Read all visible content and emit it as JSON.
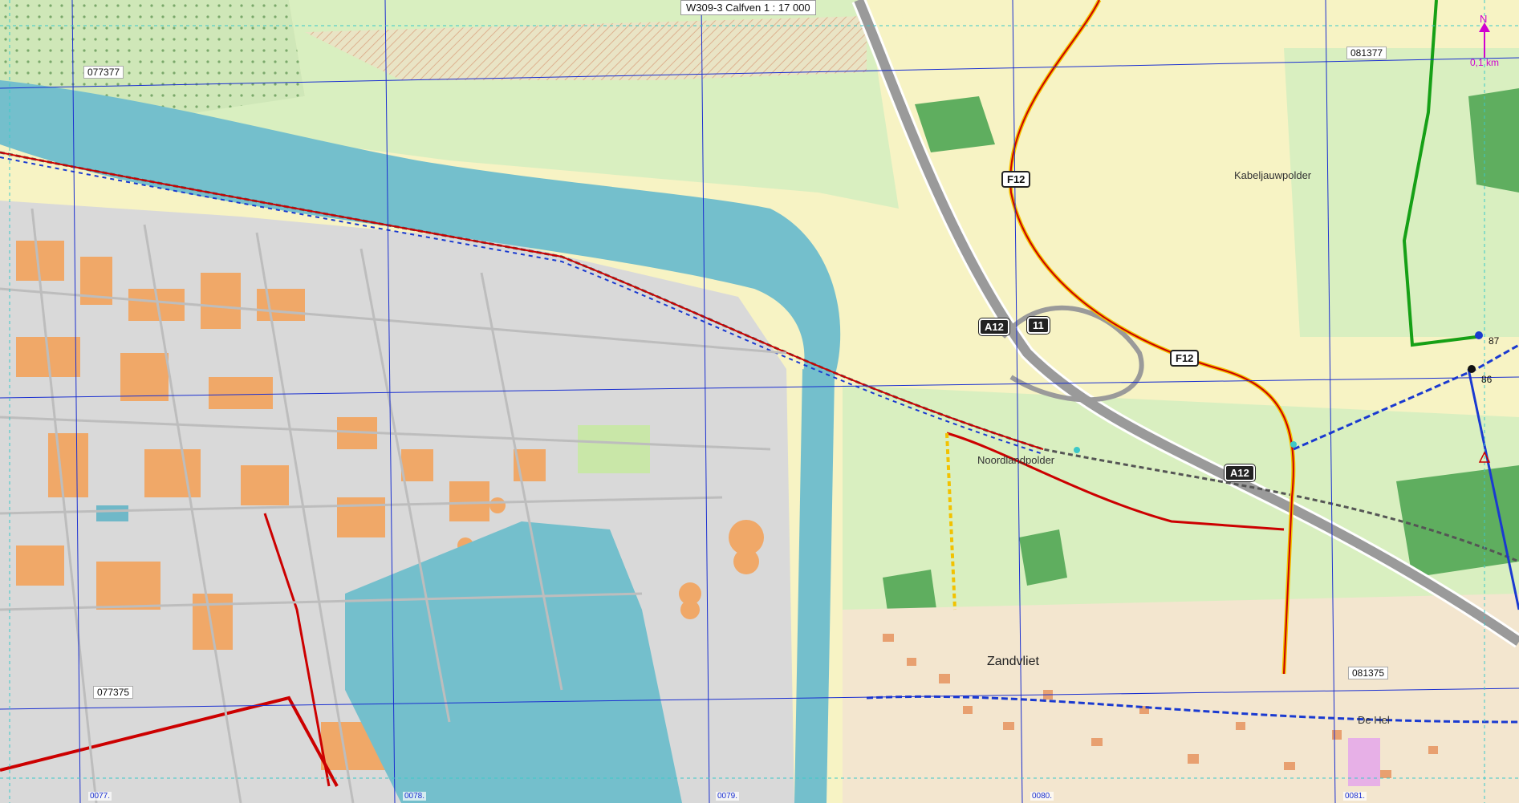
{
  "map_title": "W309-3 Calfven 1 : 17 000",
  "scale_bar": {
    "label": "0,1 km",
    "north": "N"
  },
  "grid_labels": [
    "077377",
    "081377",
    "077375",
    "081375"
  ],
  "edge_labels": [
    "0077.",
    "0078.",
    "0079.",
    "0080.",
    "0081."
  ],
  "place_labels": {
    "kabeljauwpolder": "Kabeljauwpolder",
    "noordlandpolder": "Noordlandpolder",
    "zandvliet": "Zandvliet",
    "de_hel": "De Hel"
  },
  "road_shields": [
    {
      "text": "F12",
      "style": "light"
    },
    {
      "text": "A12",
      "style": "dark"
    },
    {
      "text": "11",
      "style": "dark"
    },
    {
      "text": "F12",
      "style": "light"
    },
    {
      "text": "A12",
      "style": "dark"
    }
  ],
  "node_numbers": [
    "87",
    "86"
  ],
  "colors": {
    "water": "#74bfcc",
    "industrial": "#d9d9d9",
    "farmland": "#f7f3c4",
    "meadow": "#d9efc0",
    "forest": "#5fae5f",
    "buildings": "#f0a868",
    "grid": "#1a2fd0",
    "route_red": "#cc0000",
    "route_blue": "#1a3ad0",
    "route_yellow": "#f2c200",
    "motorway": "#9a9a9a",
    "node_route_green": "#16a016",
    "scale": "#d000d0"
  }
}
